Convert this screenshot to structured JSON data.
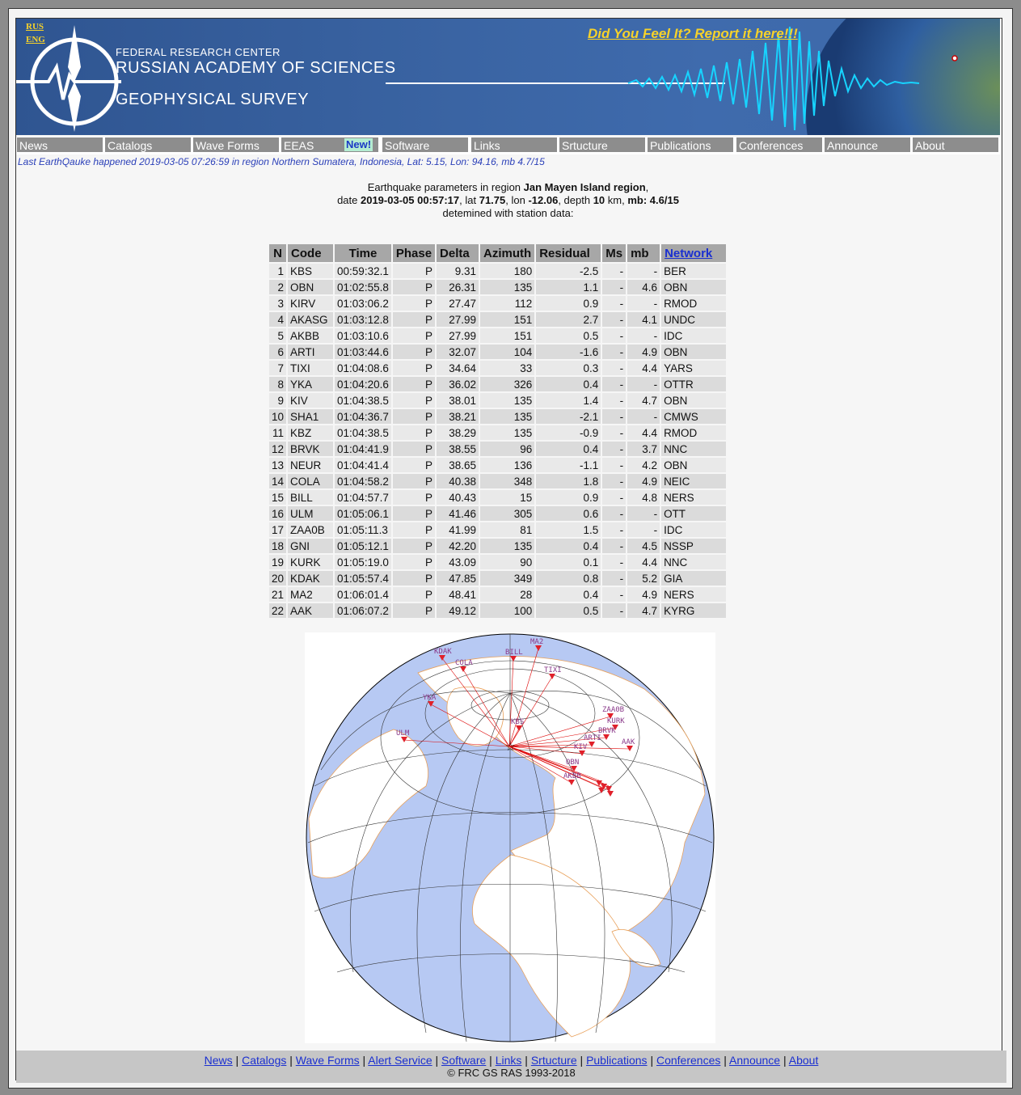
{
  "header": {
    "lang_rus": "RUS",
    "lang_eng": "ENG",
    "title_line1": "FEDERAL RESEARCH CENTER",
    "title_line2": "RUSSIAN ACADEMY OF SCIENCES",
    "title_line3": "GEOPHYSICAL SURVEY",
    "report_link": "Did You Feel It? Report it here!!!"
  },
  "nav": {
    "items": [
      "News",
      "Catalogs",
      "Wave Forms",
      "EEAS",
      "Software",
      "Links",
      "Srtucture",
      "Publications",
      "Conferences",
      "Announce",
      "About"
    ],
    "new_badge": "New!"
  },
  "last_eq": "Last EarthQauke happened 2019-03-05 07:26:59 in region Northern Sumatera, Indonesia, Lat: 5.15, Lon: 94.16, mb 4.7/15",
  "event": {
    "line1_prefix": "Earthquake parameters in region ",
    "region": "Jan Mayen Island region",
    "line1_suffix": ",",
    "date_label": "date ",
    "date": "2019-03-05 00:57:17",
    "lat_label": ", lat ",
    "lat": "71.75",
    "lon_label": ", lon ",
    "lon": "-12.06",
    "depth_label": ", depth ",
    "depth": "10",
    "km_label": " km, ",
    "mb_label": "mb: 4.6/15",
    "line3": "detemined with station data:"
  },
  "table": {
    "headers": [
      "N",
      "Code",
      "Time",
      "Phase",
      "Delta",
      "Azimuth",
      "Residual",
      "Ms",
      "mb",
      "Network"
    ],
    "rows": [
      [
        "1",
        "KBS",
        "00:59:32.1",
        "P",
        "9.31",
        "180",
        "-2.5",
        "-",
        "-",
        "BER"
      ],
      [
        "2",
        "OBN",
        "01:02:55.8",
        "P",
        "26.31",
        "135",
        "1.1",
        "-",
        "4.6",
        "OBN"
      ],
      [
        "3",
        "KIRV",
        "01:03:06.2",
        "P",
        "27.47",
        "112",
        "0.9",
        "-",
        "-",
        "RMOD"
      ],
      [
        "4",
        "AKASG",
        "01:03:12.8",
        "P",
        "27.99",
        "151",
        "2.7",
        "-",
        "4.1",
        "UNDC"
      ],
      [
        "5",
        "AKBB",
        "01:03:10.6",
        "P",
        "27.99",
        "151",
        "0.5",
        "-",
        "-",
        "IDC"
      ],
      [
        "6",
        "ARTI",
        "01:03:44.6",
        "P",
        "32.07",
        "104",
        "-1.6",
        "-",
        "4.9",
        "OBN"
      ],
      [
        "7",
        "TIXI",
        "01:04:08.6",
        "P",
        "34.64",
        "33",
        "0.3",
        "-",
        "4.4",
        "YARS"
      ],
      [
        "8",
        "YKA",
        "01:04:20.6",
        "P",
        "36.02",
        "326",
        "0.4",
        "-",
        "-",
        "OTTR"
      ],
      [
        "9",
        "KIV",
        "01:04:38.5",
        "P",
        "38.01",
        "135",
        "1.4",
        "-",
        "4.7",
        "OBN"
      ],
      [
        "10",
        "SHA1",
        "01:04:36.7",
        "P",
        "38.21",
        "135",
        "-2.1",
        "-",
        "-",
        "CMWS"
      ],
      [
        "11",
        "KBZ",
        "01:04:38.5",
        "P",
        "38.29",
        "135",
        "-0.9",
        "-",
        "4.4",
        "RMOD"
      ],
      [
        "12",
        "BRVK",
        "01:04:41.9",
        "P",
        "38.55",
        "96",
        "0.4",
        "-",
        "3.7",
        "NNC"
      ],
      [
        "13",
        "NEUR",
        "01:04:41.4",
        "P",
        "38.65",
        "136",
        "-1.1",
        "-",
        "4.2",
        "OBN"
      ],
      [
        "14",
        "COLA",
        "01:04:58.2",
        "P",
        "40.38",
        "348",
        "1.8",
        "-",
        "4.9",
        "NEIC"
      ],
      [
        "15",
        "BILL",
        "01:04:57.7",
        "P",
        "40.43",
        "15",
        "0.9",
        "-",
        "4.8",
        "NERS"
      ],
      [
        "16",
        "ULM",
        "01:05:06.1",
        "P",
        "41.46",
        "305",
        "0.6",
        "-",
        "-",
        "OTT"
      ],
      [
        "17",
        "ZAA0B",
        "01:05:11.3",
        "P",
        "41.99",
        "81",
        "1.5",
        "-",
        "-",
        "IDC"
      ],
      [
        "18",
        "GNI",
        "01:05:12.1",
        "P",
        "42.20",
        "135",
        "0.4",
        "-",
        "4.5",
        "NSSP"
      ],
      [
        "19",
        "KURK",
        "01:05:19.0",
        "P",
        "43.09",
        "90",
        "0.1",
        "-",
        "4.4",
        "NNC"
      ],
      [
        "20",
        "KDAK",
        "01:05:57.4",
        "P",
        "47.85",
        "349",
        "0.8",
        "-",
        "5.2",
        "GIA"
      ],
      [
        "21",
        "MA2",
        "01:06:01.4",
        "P",
        "48.41",
        "28",
        "0.4",
        "-",
        "4.9",
        "NERS"
      ],
      [
        "22",
        "AAK",
        "01:06:07.2",
        "P",
        "49.12",
        "100",
        "0.5",
        "-",
        "4.7",
        "KYRG"
      ]
    ]
  },
  "map_labels": [
    "KDAK",
    "COLA",
    "BILL",
    "MA2",
    "TIXI",
    "YKA",
    "ULM",
    "KBS",
    "ZAA0B",
    "KURK",
    "BRVK",
    "ARTI",
    "AAK",
    "KIV",
    "OBN",
    "AKBB"
  ],
  "footer": {
    "links": [
      "News",
      "Catalogs",
      "Wave Forms",
      "Alert Service",
      "Software",
      "Links",
      "Srtucture",
      "Publications",
      "Conferences",
      "Announce",
      "About"
    ],
    "copyright": "© FRC GS RAS 1993-2018"
  },
  "colors": {
    "banner": "#3a64a3",
    "accent_yellow": "#f7d229",
    "link_blue": "#1a2fd0",
    "nav_grey": "#8d8d8d"
  }
}
